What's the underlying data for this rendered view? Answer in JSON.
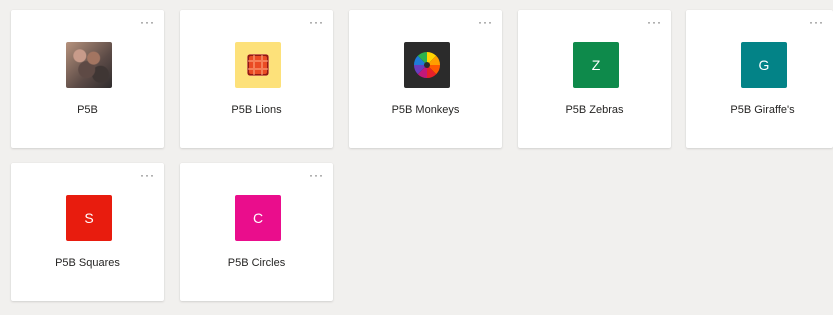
{
  "teams": [
    {
      "name": "P5B",
      "more": "···",
      "tile": {
        "kind": "photo",
        "letter": ""
      }
    },
    {
      "name": "P5B Lions",
      "more": "···",
      "tile": {
        "kind": "lions-icon",
        "letter": ""
      }
    },
    {
      "name": "P5B Monkeys",
      "more": "···",
      "tile": {
        "kind": "color-wheel-icon",
        "letter": ""
      }
    },
    {
      "name": "P5B Zebras",
      "more": "···",
      "tile": {
        "kind": "letter",
        "letter": "Z",
        "color": "#0e8a4b"
      }
    },
    {
      "name": "P5B Giraffe's",
      "more": "···",
      "tile": {
        "kind": "letter",
        "letter": "G",
        "color": "#038387"
      }
    },
    {
      "name": "P5B Squares",
      "more": "···",
      "tile": {
        "kind": "letter",
        "letter": "S",
        "color": "#e81c0e"
      }
    },
    {
      "name": "P5B Circles",
      "more": "···",
      "tile": {
        "kind": "letter",
        "letter": "C",
        "color": "#ea0d8c"
      }
    }
  ]
}
